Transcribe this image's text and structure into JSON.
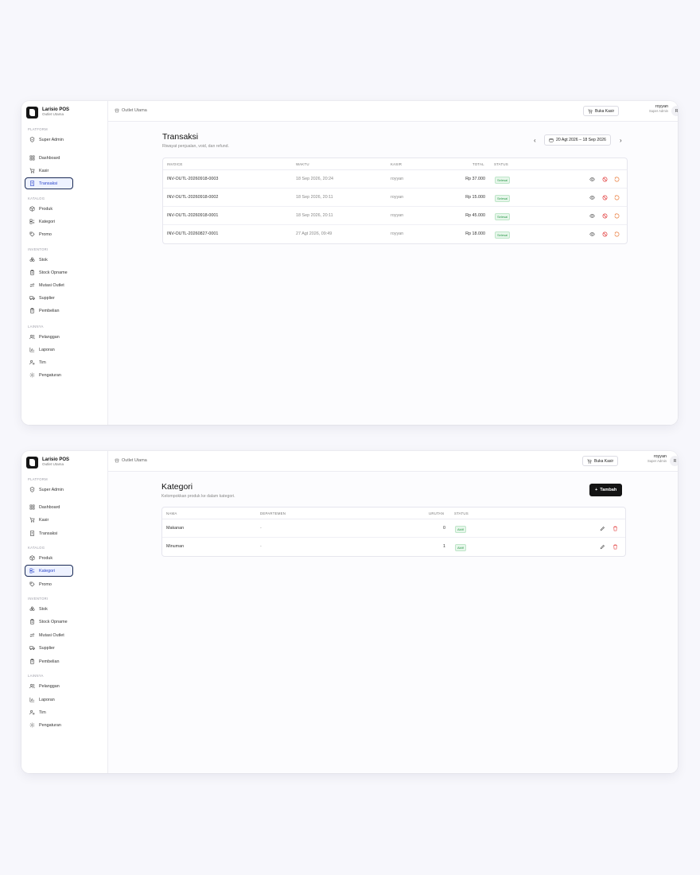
{
  "app": {
    "name": "Larisio POS",
    "outlet_sub": "Outlet Utama"
  },
  "sidebar": {
    "sections": {
      "platform": "PLATFORM",
      "katalog": "KATALOG",
      "inventori": "INVENTORI",
      "lainnya": "LAINNYA"
    },
    "items": {
      "super_admin": "Super Admin",
      "dashboard": "Dashboard",
      "kasir": "Kasir",
      "transaksi": "Transaksi",
      "produk": "Produk",
      "kategori": "Kategori",
      "promo": "Promo",
      "stok": "Stok",
      "stock_opname": "Stock Opname",
      "mutasi_outlet": "Mutasi Outlet",
      "supplier": "Supplier",
      "pembelian": "Pembelian",
      "pelanggan": "Pelanggan",
      "laporan": "Laporan",
      "tim": "Tim",
      "pengaturan": "Pengaturan"
    }
  },
  "topbar": {
    "outlet": "Outlet Utama",
    "buka_kasir": "Buka Kasir",
    "user_name": "royyan",
    "user_role": "Super Admin",
    "avatar": "R"
  },
  "transaksi": {
    "title": "Transaksi",
    "subtitle": "Riwayat penjualan, void, dan refund.",
    "date_range": "20 Agt 2026 – 18 Sep 2026",
    "columns": {
      "invoice": "INVOICE",
      "waktu": "WAKTU",
      "kasir": "KASIR",
      "total": "TOTAL",
      "status": "STATUS"
    },
    "rows": [
      {
        "invoice": "INV-OUTL-20260918-0003",
        "waktu": "18 Sep 2026, 20:24",
        "kasir": "royyan",
        "total": "Rp 37.000",
        "status": "Selesai"
      },
      {
        "invoice": "INV-OUTL-20260918-0002",
        "waktu": "18 Sep 2026, 20:11",
        "kasir": "royyan",
        "total": "Rp 15.000",
        "status": "Selesai"
      },
      {
        "invoice": "INV-OUTL-20260918-0001",
        "waktu": "18 Sep 2026, 20:11",
        "kasir": "royyan",
        "total": "Rp 45.000",
        "status": "Selesai"
      },
      {
        "invoice": "INV-OUTL-20260827-0001",
        "waktu": "27 Agt 2026, 09:49",
        "kasir": "royyan",
        "total": "Rp 18.000",
        "status": "Selesai"
      }
    ]
  },
  "kategori": {
    "title": "Kategori",
    "subtitle": "Kelompokkan produk ke dalam kategori.",
    "add_label": "Tambah",
    "columns": {
      "nama": "NAMA",
      "departemen": "DEPARTEMEN",
      "urutan": "URUTAN",
      "status": "STATUS"
    },
    "rows": [
      {
        "nama": "Makanan",
        "departemen": "-",
        "urutan": "0",
        "status": "Aktif"
      },
      {
        "nama": "Minuman",
        "departemen": "-",
        "urutan": "1",
        "status": "Aktif"
      }
    ]
  },
  "colors": {
    "accent": "#2a45c9",
    "active_bg": "#eef2ff",
    "success": "#2b9a4a",
    "danger": "#e03030",
    "refund": "#e8702a"
  },
  "icons": [
    "shield-icon",
    "dashboard-icon",
    "cart-icon",
    "receipt-icon",
    "package-icon",
    "tag-icon",
    "store-icon",
    "calendar-icon",
    "eye-icon",
    "ban-icon",
    "refund-icon",
    "edit-icon",
    "trash-icon",
    "logout-icon",
    "plus-icon"
  ]
}
